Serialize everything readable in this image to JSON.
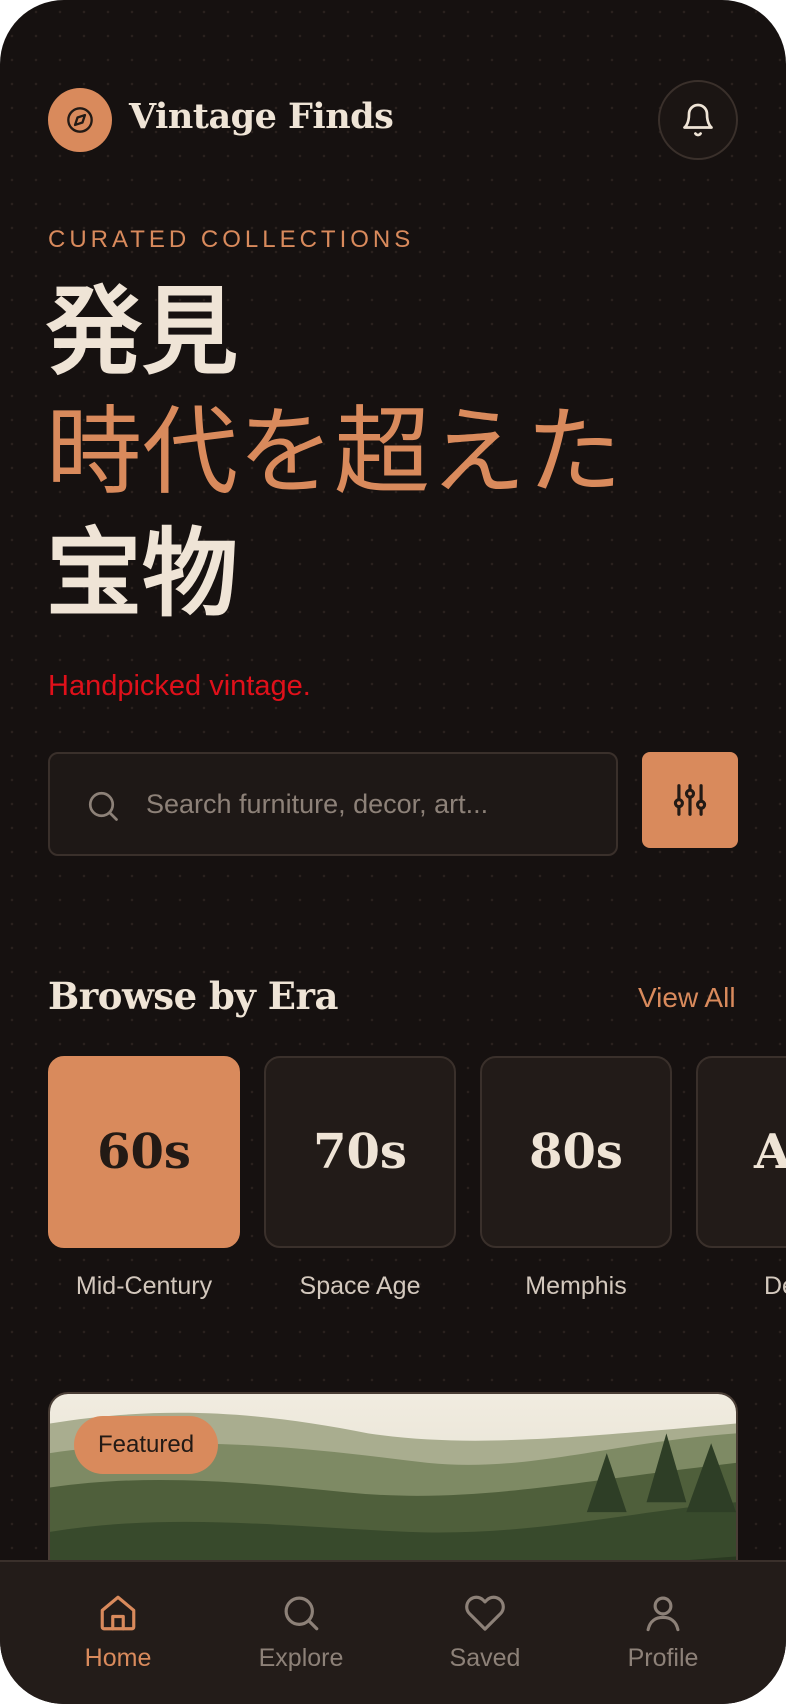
{
  "header": {
    "brand": "Vintage Finds",
    "logo_icon": "compass-icon",
    "notification_icon": "bell-icon"
  },
  "hero": {
    "eyebrow": "CURATED COLLECTIONS",
    "line1": "発見",
    "line2": "時代を超えた",
    "line3": "宝物",
    "tagline": "Handpicked vintage."
  },
  "search": {
    "placeholder": "Search furniture, decor, art...",
    "value": "",
    "filter_icon": "sliders-icon"
  },
  "eras": {
    "title": "Browse by Era",
    "view_all": "View All",
    "items": [
      {
        "decade": "60s",
        "label": "Mid-Century",
        "active": true
      },
      {
        "decade": "70s",
        "label": "Space Age",
        "active": false
      },
      {
        "decade": "80s",
        "label": "Memphis",
        "active": false
      },
      {
        "decade": "A",
        "label": "De",
        "active": false
      }
    ]
  },
  "featured": {
    "badge": "Featured"
  },
  "nav": {
    "items": [
      {
        "label": "Home",
        "icon": "home-icon",
        "active": true
      },
      {
        "label": "Explore",
        "icon": "search-icon",
        "active": false
      },
      {
        "label": "Saved",
        "icon": "heart-icon",
        "active": false
      },
      {
        "label": "Profile",
        "icon": "user-icon",
        "active": false
      }
    ]
  },
  "colors": {
    "background": "#161110",
    "accent": "#d98a5c",
    "text": "#efe4d6",
    "tagline": "#e0101a"
  }
}
